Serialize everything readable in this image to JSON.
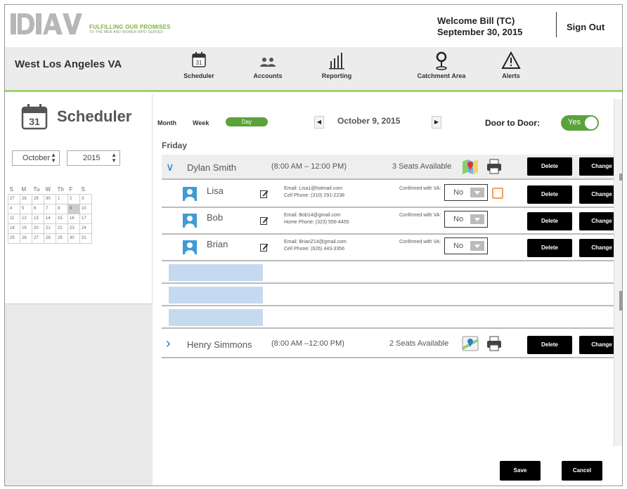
{
  "header": {
    "logo_text": "DAV",
    "tagline_1": "FULFILLING OUR PROMISES",
    "tagline_2": "TO THE MEN AND WOMEN WHO SERVED",
    "welcome": "Welcome Bill (TC)",
    "date": "September 30, 2015",
    "sign_out": "Sign Out"
  },
  "nav": {
    "site": "West Los Angeles VA",
    "items": [
      {
        "label": "Scheduler",
        "icon": "calendar-icon"
      },
      {
        "label": "Accounts",
        "icon": "users-icon"
      },
      {
        "label": "Reporting",
        "icon": "bar-chart-icon"
      },
      {
        "label": "Catchment Area",
        "icon": "map-pin-icon"
      },
      {
        "label": "Alerts",
        "icon": "warning-icon"
      }
    ]
  },
  "sidebar": {
    "title": "Scheduler",
    "calendar_icon_day": "31",
    "month_select": "October",
    "year_select": "2015",
    "weekdays": [
      "S",
      "M",
      "Tu",
      "W",
      "Th",
      "F",
      "S"
    ],
    "weeks": [
      [
        "27",
        "28",
        "29",
        "30",
        "1",
        "2",
        "3"
      ],
      [
        "4",
        "5",
        "6",
        "7",
        "8",
        "9",
        "10"
      ],
      [
        "11",
        "12",
        "13",
        "14",
        "15",
        "16",
        "17"
      ],
      [
        "18",
        "19",
        "20",
        "21",
        "22",
        "23",
        "24"
      ],
      [
        "25",
        "26",
        "27",
        "28",
        "29",
        "30",
        "31"
      ]
    ],
    "selected_day": "9"
  },
  "toolbar": {
    "month": "Month",
    "week": "Week",
    "day": "Day",
    "prev": "◀",
    "next": "▶",
    "current_date": "October 9, 2015",
    "door_to_door_label": "Door to Door:",
    "door_to_door_value": "Yes"
  },
  "schedule": {
    "day_label": "Friday",
    "groups": [
      {
        "driver": "Dylan Smith",
        "time": "(8:00 AM – 12:00 PM)",
        "seats": "3 Seats Available",
        "delete": "Delete",
        "change": "Change",
        "riders": [
          {
            "name": "Lisa",
            "email": "Email: Lisa1@hotmail.com",
            "phone": "Cell Phone: (310) 291-2238",
            "confirmed_label": "Confirmed with VA:",
            "confirmed": "No",
            "delete": "Delete",
            "change": "Change"
          },
          {
            "name": "Bob",
            "email": "Email: Bob14@gmail.com",
            "phone": "Home Phone: (323) 556-4455",
            "confirmed_label": "Confirmed with VA:",
            "confirmed": "No",
            "delete": "Delete",
            "change": "Change"
          },
          {
            "name": "Brian",
            "email": "Email: BrianZ14@gmail.com",
            "phone": "Cell Phone: (626) 443-3356",
            "confirmed_label": "Confirmed with VA:",
            "confirmed": "No",
            "delete": "Delete",
            "change": "Change"
          }
        ]
      },
      {
        "driver": "Henry Simmons",
        "time": "(8:00 AM –12:00 PM)",
        "seats": "2 Seats Available",
        "delete": "Delete",
        "change": "Change"
      }
    ]
  },
  "footer": {
    "save": "Save",
    "cancel": "Cancel"
  },
  "colors": {
    "accent_green": "#5aa33b",
    "nav_underline": "#9dd36b",
    "link_blue": "#2a7ec2",
    "empty_slot": "#c5daf0"
  }
}
